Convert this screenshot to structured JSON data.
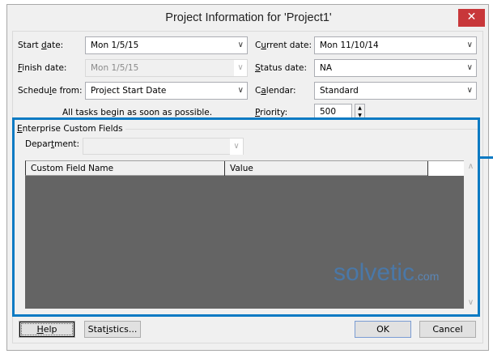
{
  "dialog": {
    "title": "Project Information for 'Project1'",
    "close_icon": "close-icon"
  },
  "fields": {
    "start_date": {
      "label_pre": "Start ",
      "label_u": "d",
      "label_post": "ate:",
      "value": "Mon 1/5/15"
    },
    "finish_date": {
      "label_pre": "",
      "label_u": "F",
      "label_post": "inish date:",
      "value": "Mon 1/5/15"
    },
    "schedule_from": {
      "label_pre": "Schedu",
      "label_u": "l",
      "label_post": "e from:",
      "value": "Project Start Date"
    },
    "current_date": {
      "label_pre": "C",
      "label_u": "u",
      "label_post": "rrent date:",
      "value": "Mon 11/10/14"
    },
    "status_date": {
      "label_pre": "",
      "label_u": "S",
      "label_post": "tatus date:",
      "value": "NA"
    },
    "calendar": {
      "label_pre": "C",
      "label_u": "a",
      "label_post": "lendar:",
      "value": "Standard"
    },
    "priority": {
      "label_pre": "",
      "label_u": "P",
      "label_post": "riority:",
      "value": "500"
    },
    "schedule_note": "All tasks begin as soon as possible."
  },
  "enterprise": {
    "group_label_u": "E",
    "group_label_post": "nterprise Custom Fields",
    "department": {
      "label_pre": "Depar",
      "label_u": "t",
      "label_post": "ment:",
      "value": ""
    },
    "columns": [
      "Custom Field Name",
      "Value"
    ]
  },
  "watermark": {
    "text": "solvetic",
    "suffix": ".com"
  },
  "buttons": {
    "help_u": "H",
    "help_post": "elp",
    "statistics_pre": "Stat",
    "statistics_u": "i",
    "statistics_post": "stics...",
    "ok": "OK",
    "cancel": "Cancel"
  },
  "colors": {
    "highlight": "#0b7ac3",
    "close": "#c8373a"
  }
}
